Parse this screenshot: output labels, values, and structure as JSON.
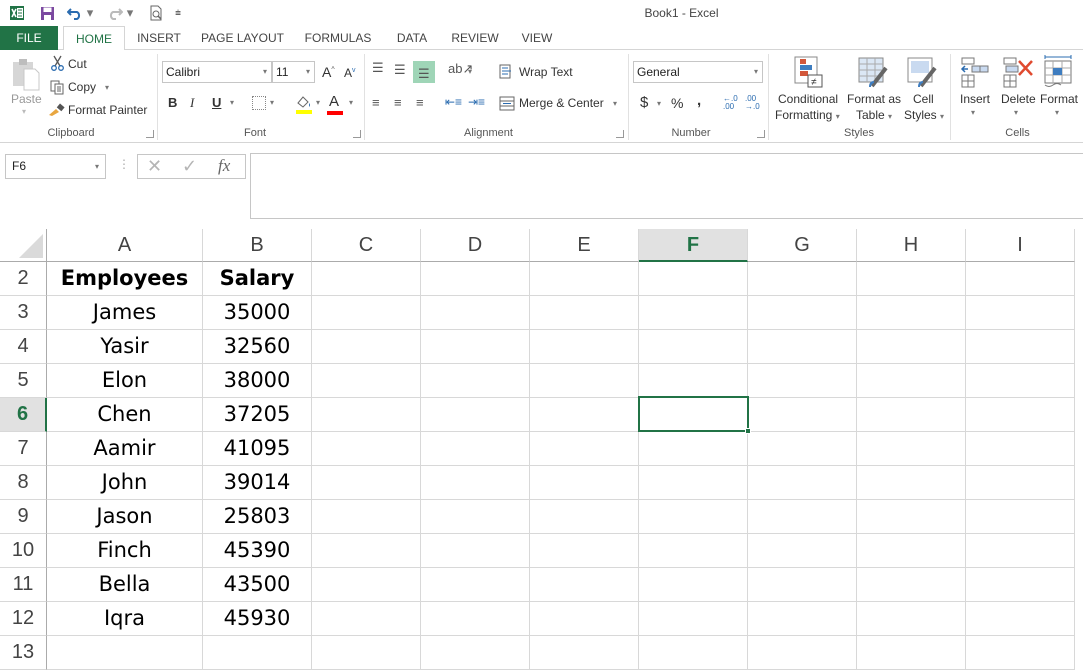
{
  "window": {
    "title": "Book1 - Excel"
  },
  "quick_access": {
    "icons": [
      "excel-logo-icon",
      "save-icon",
      "undo-icon",
      "redo-icon",
      "print-preview-icon",
      "customize-qat-icon"
    ]
  },
  "tabs": [
    {
      "label": "FILE"
    },
    {
      "label": "HOME",
      "active": true
    },
    {
      "label": "INSERT"
    },
    {
      "label": "PAGE LAYOUT"
    },
    {
      "label": "FORMULAS"
    },
    {
      "label": "DATA"
    },
    {
      "label": "REVIEW"
    },
    {
      "label": "VIEW"
    }
  ],
  "ribbon": {
    "clipboard": {
      "label": "Clipboard",
      "paste": "Paste",
      "cut": "Cut",
      "copy": "Copy",
      "format_painter": "Format Painter"
    },
    "font": {
      "label": "Font",
      "font_name": "Calibri",
      "font_size": "11",
      "bold": "B",
      "italic": "I",
      "underline": "U",
      "grow": "A",
      "shrink": "A",
      "font_color": "A",
      "fill_color_hex": "#ffff00",
      "font_color_hex": "#ff0000"
    },
    "alignment": {
      "label": "Alignment",
      "wrap_text": "Wrap Text",
      "merge_center": "Merge & Center"
    },
    "number": {
      "label": "Number",
      "format": "General",
      "currency": "$",
      "percent": "%",
      "comma": ",",
      "inc_decimal": "←.0 .00",
      "dec_decimal": ".00 →.0"
    },
    "styles": {
      "label": "Styles",
      "conditional_1": "Conditional",
      "conditional_2": "Formatting",
      "format_table_1": "Format as",
      "format_table_2": "Table",
      "cell_styles_1": "Cell",
      "cell_styles_2": "Styles"
    },
    "cells": {
      "label": "Cells",
      "insert": "Insert",
      "delete": "Delete",
      "format": "Format"
    }
  },
  "formula_bar": {
    "name_box": "F6",
    "cancel": "✕",
    "enter": "✓",
    "fx": "fx",
    "value": ""
  },
  "sheet": {
    "columns": [
      "A",
      "B",
      "C",
      "D",
      "E",
      "F",
      "G",
      "H",
      "I"
    ],
    "selected_column": "F",
    "selected_row": 6,
    "active_cell": "F6",
    "accent_color": "#217346",
    "rows": [
      {
        "num": "2",
        "a": "Employees",
        "b": "Salary",
        "header": true
      },
      {
        "num": "3",
        "a": "James",
        "b": "35000"
      },
      {
        "num": "4",
        "a": "Yasir",
        "b": "32560"
      },
      {
        "num": "5",
        "a": "Elon",
        "b": "38000"
      },
      {
        "num": "6",
        "a": "Chen",
        "b": "37205"
      },
      {
        "num": "7",
        "a": "Aamir",
        "b": "41095"
      },
      {
        "num": "8",
        "a": "John",
        "b": "39014"
      },
      {
        "num": "9",
        "a": "Jason",
        "b": "25803"
      },
      {
        "num": "10",
        "a": "Finch",
        "b": "45390"
      },
      {
        "num": "11",
        "a": "Bella",
        "b": "43500"
      },
      {
        "num": "12",
        "a": "Iqra",
        "b": "45930"
      },
      {
        "num": "13",
        "a": "",
        "b": ""
      }
    ]
  }
}
